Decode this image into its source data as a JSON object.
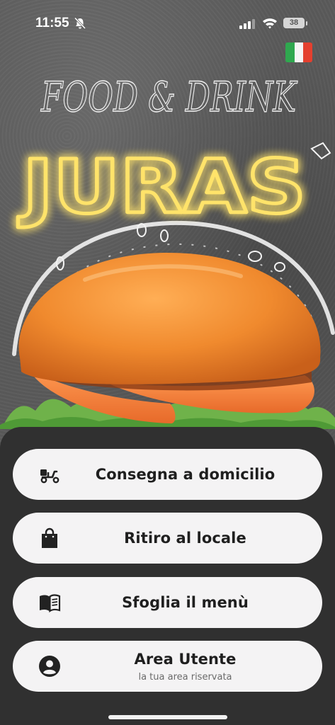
{
  "status_bar": {
    "time": "11:55",
    "battery": "38"
  },
  "hero": {
    "tagline": "FOOD & DRINK",
    "brand": "JURAS"
  },
  "language_flag": "italian-flag",
  "actions": [
    {
      "label": "Consegna a domicilio",
      "icon": "scooter-icon"
    },
    {
      "label": "Ritiro al locale",
      "icon": "shopping-bag-icon"
    },
    {
      "label": "Sfoglia il menù",
      "icon": "menu-book-icon"
    },
    {
      "label": "Area Utente",
      "sublabel": "la tua area riservata",
      "icon": "user-circle-icon"
    }
  ],
  "colors": {
    "panel": "#303030",
    "button": "#f4f3f4",
    "neon": "#ffe36a",
    "flag_green": "#2fa84f",
    "flag_white": "#f5f5f5",
    "flag_red": "#e4402f"
  }
}
